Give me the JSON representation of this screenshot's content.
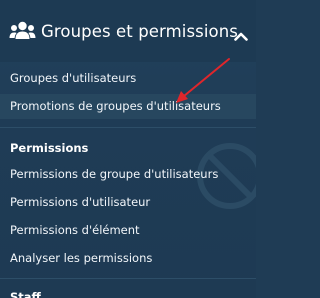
{
  "header": {
    "title": "Groupes et permissions",
    "icon": "users-group-icon",
    "chevron": "chevron-up-icon"
  },
  "groups": [
    {
      "label": "Groupes d'utilisateurs"
    },
    {
      "label": "Promotions de groupes d'utilisateurs"
    }
  ],
  "permissions_section": {
    "heading": "Permissions",
    "items": [
      {
        "label": "Permissions de groupe d'utilisateurs"
      },
      {
        "label": "Permissions d'utilisateur"
      },
      {
        "label": "Permissions d'élément"
      },
      {
        "label": "Analyser les permissions"
      }
    ]
  },
  "next_section": {
    "heading": "Staff"
  },
  "colors": {
    "background": "#1f3c55",
    "text": "#ffffff",
    "annotation_arrow": "#e0262b"
  }
}
